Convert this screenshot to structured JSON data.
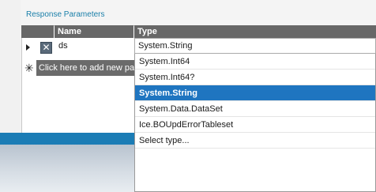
{
  "section": {
    "title": "Response Parameters"
  },
  "grid": {
    "headers": {
      "name": "Name",
      "type": "Type"
    },
    "row": {
      "name": "ds",
      "type": "System.String",
      "delete_glyph": "✕"
    },
    "add_row_star": "✳",
    "add_row_label": "Click here to add new parameter"
  },
  "dropdown": {
    "options": [
      "System.Int64",
      "System.Int64?",
      "System.String",
      "System.Data.DataSet",
      "Ice.BOUpdErrorTableset",
      "Select type..."
    ],
    "selected_index": 2
  },
  "colors": {
    "section_title": "#1a7fa9",
    "header_bg": "#676767",
    "selected_bg": "#1f75c0",
    "blue_bar": "#1b7cb5"
  }
}
